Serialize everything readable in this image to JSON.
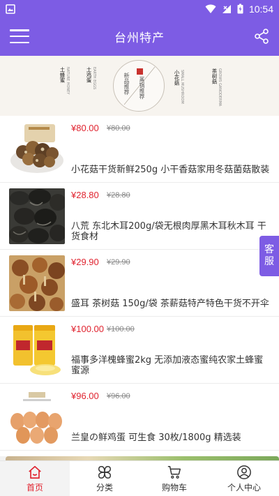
{
  "status": {
    "time": "10:54"
  },
  "app_bar": {
    "title": "台州特产"
  },
  "banner": {
    "labels": [
      "土蜂蜜",
      "土鸡蛋",
      "新品推荐",
      "蒸锅推荐",
      "小花菇",
      "茶树菇"
    ]
  },
  "products": [
    {
      "price": "¥80.00",
      "old_price": "¥80.00",
      "name": "小花菇干货新鲜250g 小干香菇家用冬菇菌菇散装"
    },
    {
      "price": "¥28.80",
      "old_price": "¥28.80",
      "name": "八荒 东北木耳200g/袋无根肉厚黑木耳秋木耳 干货食材"
    },
    {
      "price": "¥29.90",
      "old_price": "¥29.90",
      "name": "盛耳 茶树菇 150g/袋 茶薪菇特产特色干货不开伞"
    },
    {
      "price": "¥100.00",
      "old_price": "¥100.00",
      "name": "福事多洋槐蜂蜜2kg 无添加液态蜜纯农家土蜂蜜 蜜源"
    },
    {
      "price": "¥96.00",
      "old_price": "¥96.00",
      "name": "兰皇の鲜鸡蛋 可生食 30枚/1800g 精选装"
    }
  ],
  "service_button": {
    "label_1": "客",
    "label_2": "服"
  },
  "tabs": [
    {
      "label": "首页",
      "icon": "home-icon"
    },
    {
      "label": "分类",
      "icon": "category-icon"
    },
    {
      "label": "购物车",
      "icon": "cart-icon"
    },
    {
      "label": "个人中心",
      "icon": "user-icon"
    }
  ],
  "colors": {
    "primary": "#7d5ce4",
    "price": "#e0232f",
    "active_tab": "#e0232f"
  }
}
